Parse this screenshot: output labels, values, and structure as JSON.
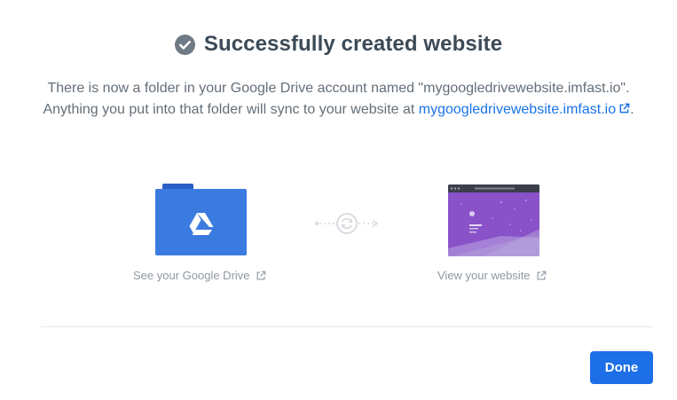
{
  "dialog": {
    "title": "Successfully created website",
    "title_icon": "check-circle-icon",
    "description_text": "There is now a folder in your Google Drive account named \"mygoogledrivewebsite.imfast.io\". Anything you put into that folder will sync to your website at ",
    "site_link": "mygoogledrivewebsite.imfast.io",
    "description_end": "."
  },
  "illustration": {
    "drive_folder_icon": "google-drive-folder-icon",
    "sync_icon": "sync-icon",
    "website_icon": "website-preview-thumbnail",
    "drive_link_label": "See your Google Drive",
    "website_link_label": "View your website"
  },
  "footer": {
    "done_label": "Done"
  },
  "colors": {
    "accent": "#1d6fe8",
    "folder": "#3b7be0",
    "website_bg": "#8a55c9",
    "title_text": "#3c4a57",
    "muted_text": "#8f98a2"
  }
}
